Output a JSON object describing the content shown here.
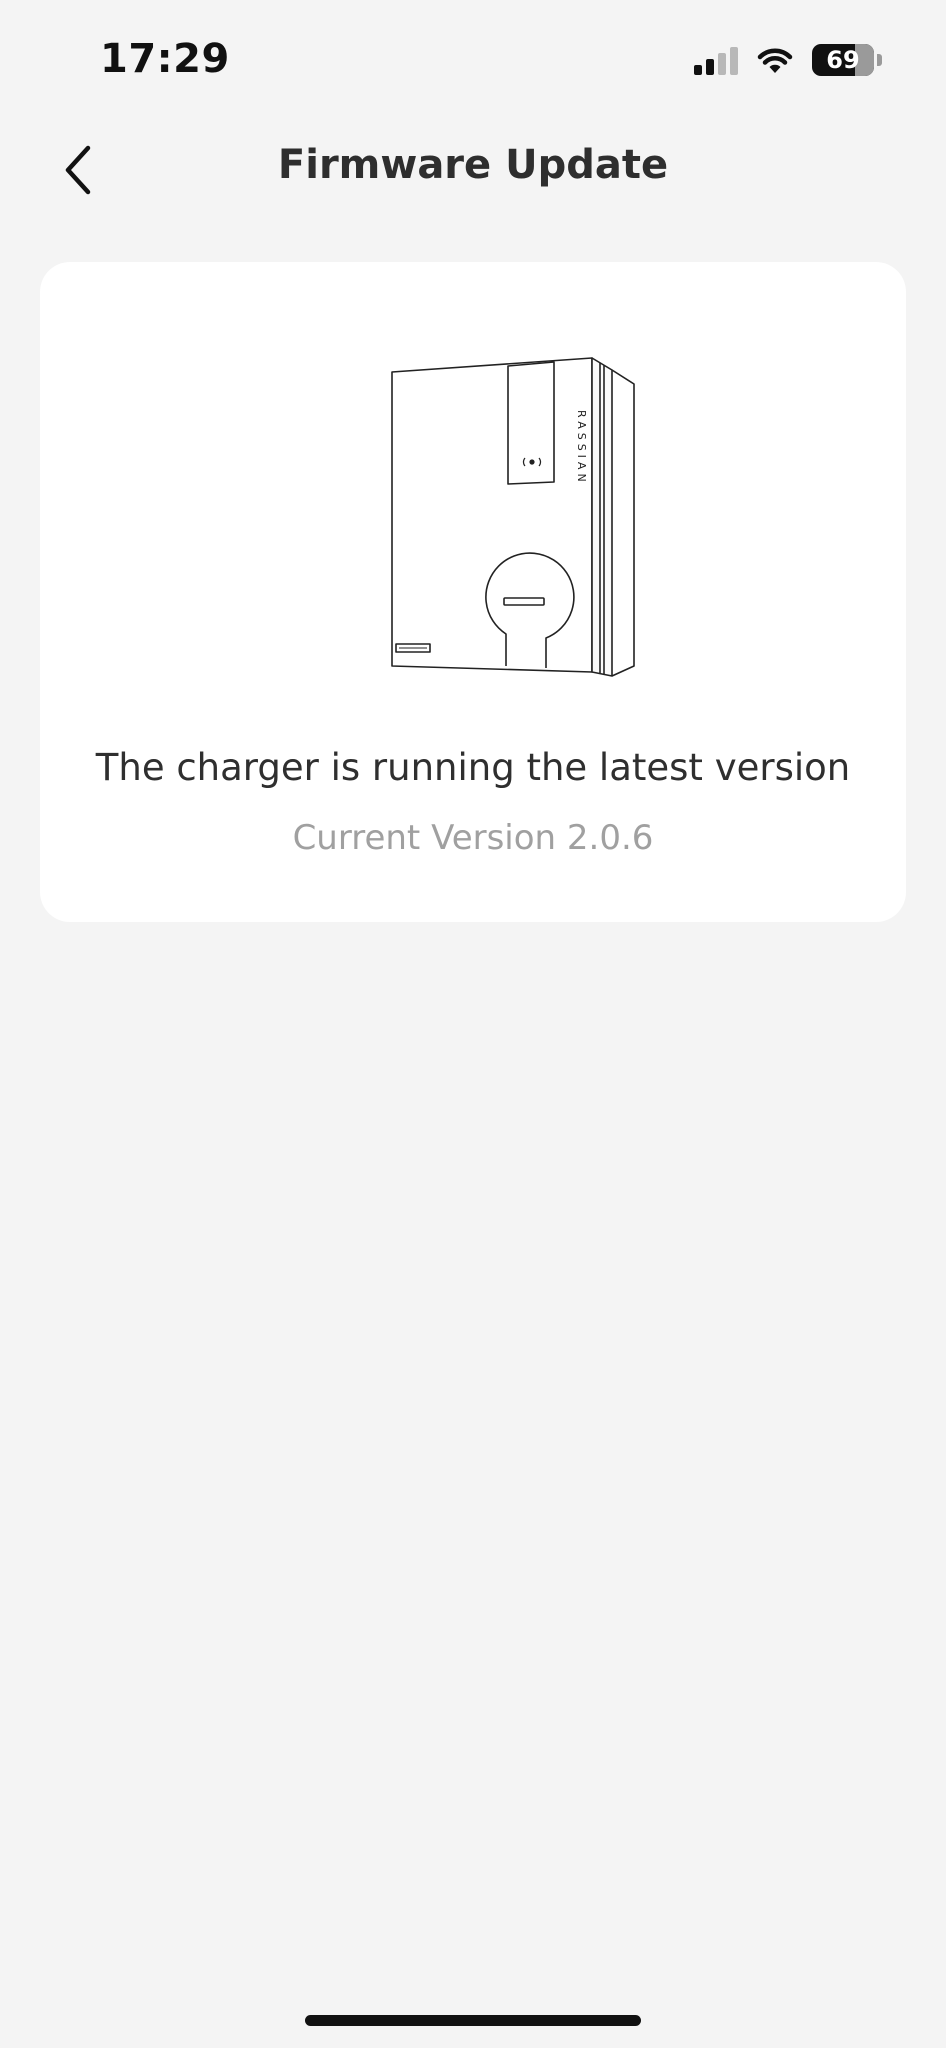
{
  "status_bar": {
    "time": "17:29",
    "battery_level": "69",
    "battery_percent": 69,
    "signal_bars_active": 2,
    "signal_bars_total": 4
  },
  "header": {
    "title": "Firmware Update",
    "back_icon": "chevron-left-icon"
  },
  "card": {
    "image": "wall-charger-illustration",
    "charger_brand_text": "RASSIAN",
    "message": "The charger is running the latest version",
    "current_version": "Current Version 2.0.6"
  },
  "colors": {
    "background": "#f4f4f4",
    "card": "#ffffff",
    "primary_text": "#2f2f2f",
    "secondary_text": "#a0a0a0"
  }
}
